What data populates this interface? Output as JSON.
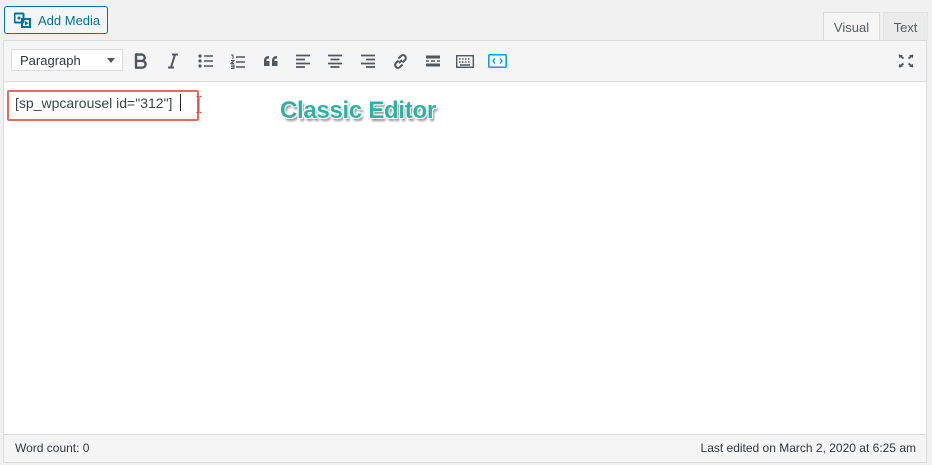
{
  "media": {
    "add_media_label": "Add Media",
    "icon": "add-media-icon"
  },
  "tabs": [
    {
      "label": "Visual",
      "active": true
    },
    {
      "label": "Text",
      "active": false
    }
  ],
  "toolbar": {
    "format_select": {
      "value": "Paragraph"
    },
    "buttons": [
      "bold-icon",
      "italic-icon",
      "bulleted-list-icon",
      "numbered-list-icon",
      "blockquote-icon",
      "align-left-icon",
      "align-center-icon",
      "align-right-icon",
      "insert-link-icon",
      "read-more-icon",
      "toolbar-toggle-icon",
      "code-embed-icon",
      "fullscreen-icon"
    ]
  },
  "content": {
    "shortcode": "[sp_wpcarousel id=\"312\"]",
    "annotation": "Classic Editor"
  },
  "status": {
    "word_count": "Word count: 0",
    "last_edited": "Last edited on March 2, 2020 at 6:25 am"
  },
  "colors": {
    "accent": "#0071a1",
    "highlight_box": "#e26b5b",
    "annotation_text": "#2fb1a3",
    "embed_icon": "#00a0d2"
  }
}
